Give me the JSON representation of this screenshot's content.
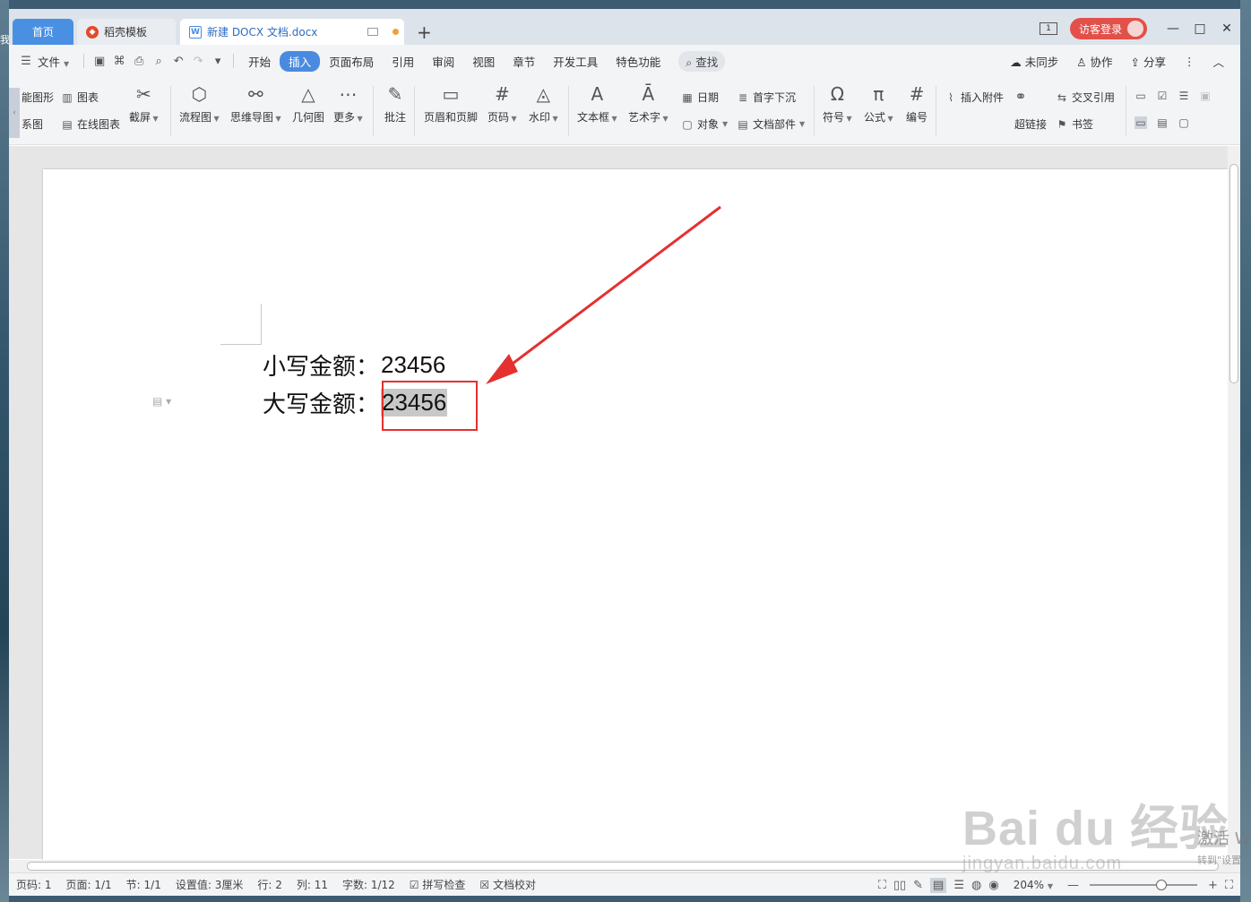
{
  "desktop": {
    "left_glyph": "我"
  },
  "tabs": {
    "home": "首页",
    "template": "稻壳模板",
    "document": "新建 DOCX 文档.docx",
    "add": "+"
  },
  "window_controls": {
    "login": "访客登录",
    "pagenum": "1",
    "minimize": "—",
    "maximize": "□",
    "close": "✕"
  },
  "menu": {
    "file": "文件",
    "items": [
      "开始",
      "插入",
      "页面布局",
      "引用",
      "审阅",
      "视图",
      "章节",
      "开发工具",
      "特色功能"
    ],
    "active": "插入",
    "search": "查找",
    "sync": "未同步",
    "collab": "协作",
    "share": "分享"
  },
  "ribbon": {
    "smart_shape": "能图形",
    "chart": "图表",
    "mind": "系图",
    "online_chart": "在线图表",
    "screenshot": "截屏",
    "flowchart": "流程图",
    "mindmap": "思维导图",
    "geometry": "几何图",
    "more": "更多",
    "comment": "批注",
    "header_footer": "页眉和页脚",
    "page_num": "页码",
    "watermark": "水印",
    "textbox": "文本框",
    "wordart": "艺术字",
    "date": "日期",
    "object": "对象",
    "dropcap": "首字下沉",
    "docpart": "文档部件",
    "symbol": "符号",
    "formula": "公式",
    "numbering": "编号",
    "attachment": "插入附件",
    "hyperlink": "超链接",
    "crossref": "交叉引用",
    "bookmark": "书签"
  },
  "document": {
    "line1_label": "小写金额：",
    "line1_value": "23456",
    "line2_label": "大写金额：",
    "line2_value": "23456"
  },
  "status": {
    "page_code": "页码: 1",
    "page": "页面: 1/1",
    "section": "节: 1/1",
    "setting": "设置值: 3厘米",
    "row": "行: 2",
    "col": "列: 11",
    "words": "字数: 1/12",
    "spell": "拼写检查",
    "proof": "文档校对",
    "zoom": "204%",
    "zoom_level": 0.67
  },
  "watermark": {
    "logo": "Bai du 经验",
    "url": "jingyan.baidu.com"
  },
  "activate": {
    "main": "激活 W",
    "sub": "转到\"设置"
  },
  "colors": {
    "accent": "#4a8be0",
    "login": "#e2504a",
    "annotation": "#e53030"
  }
}
